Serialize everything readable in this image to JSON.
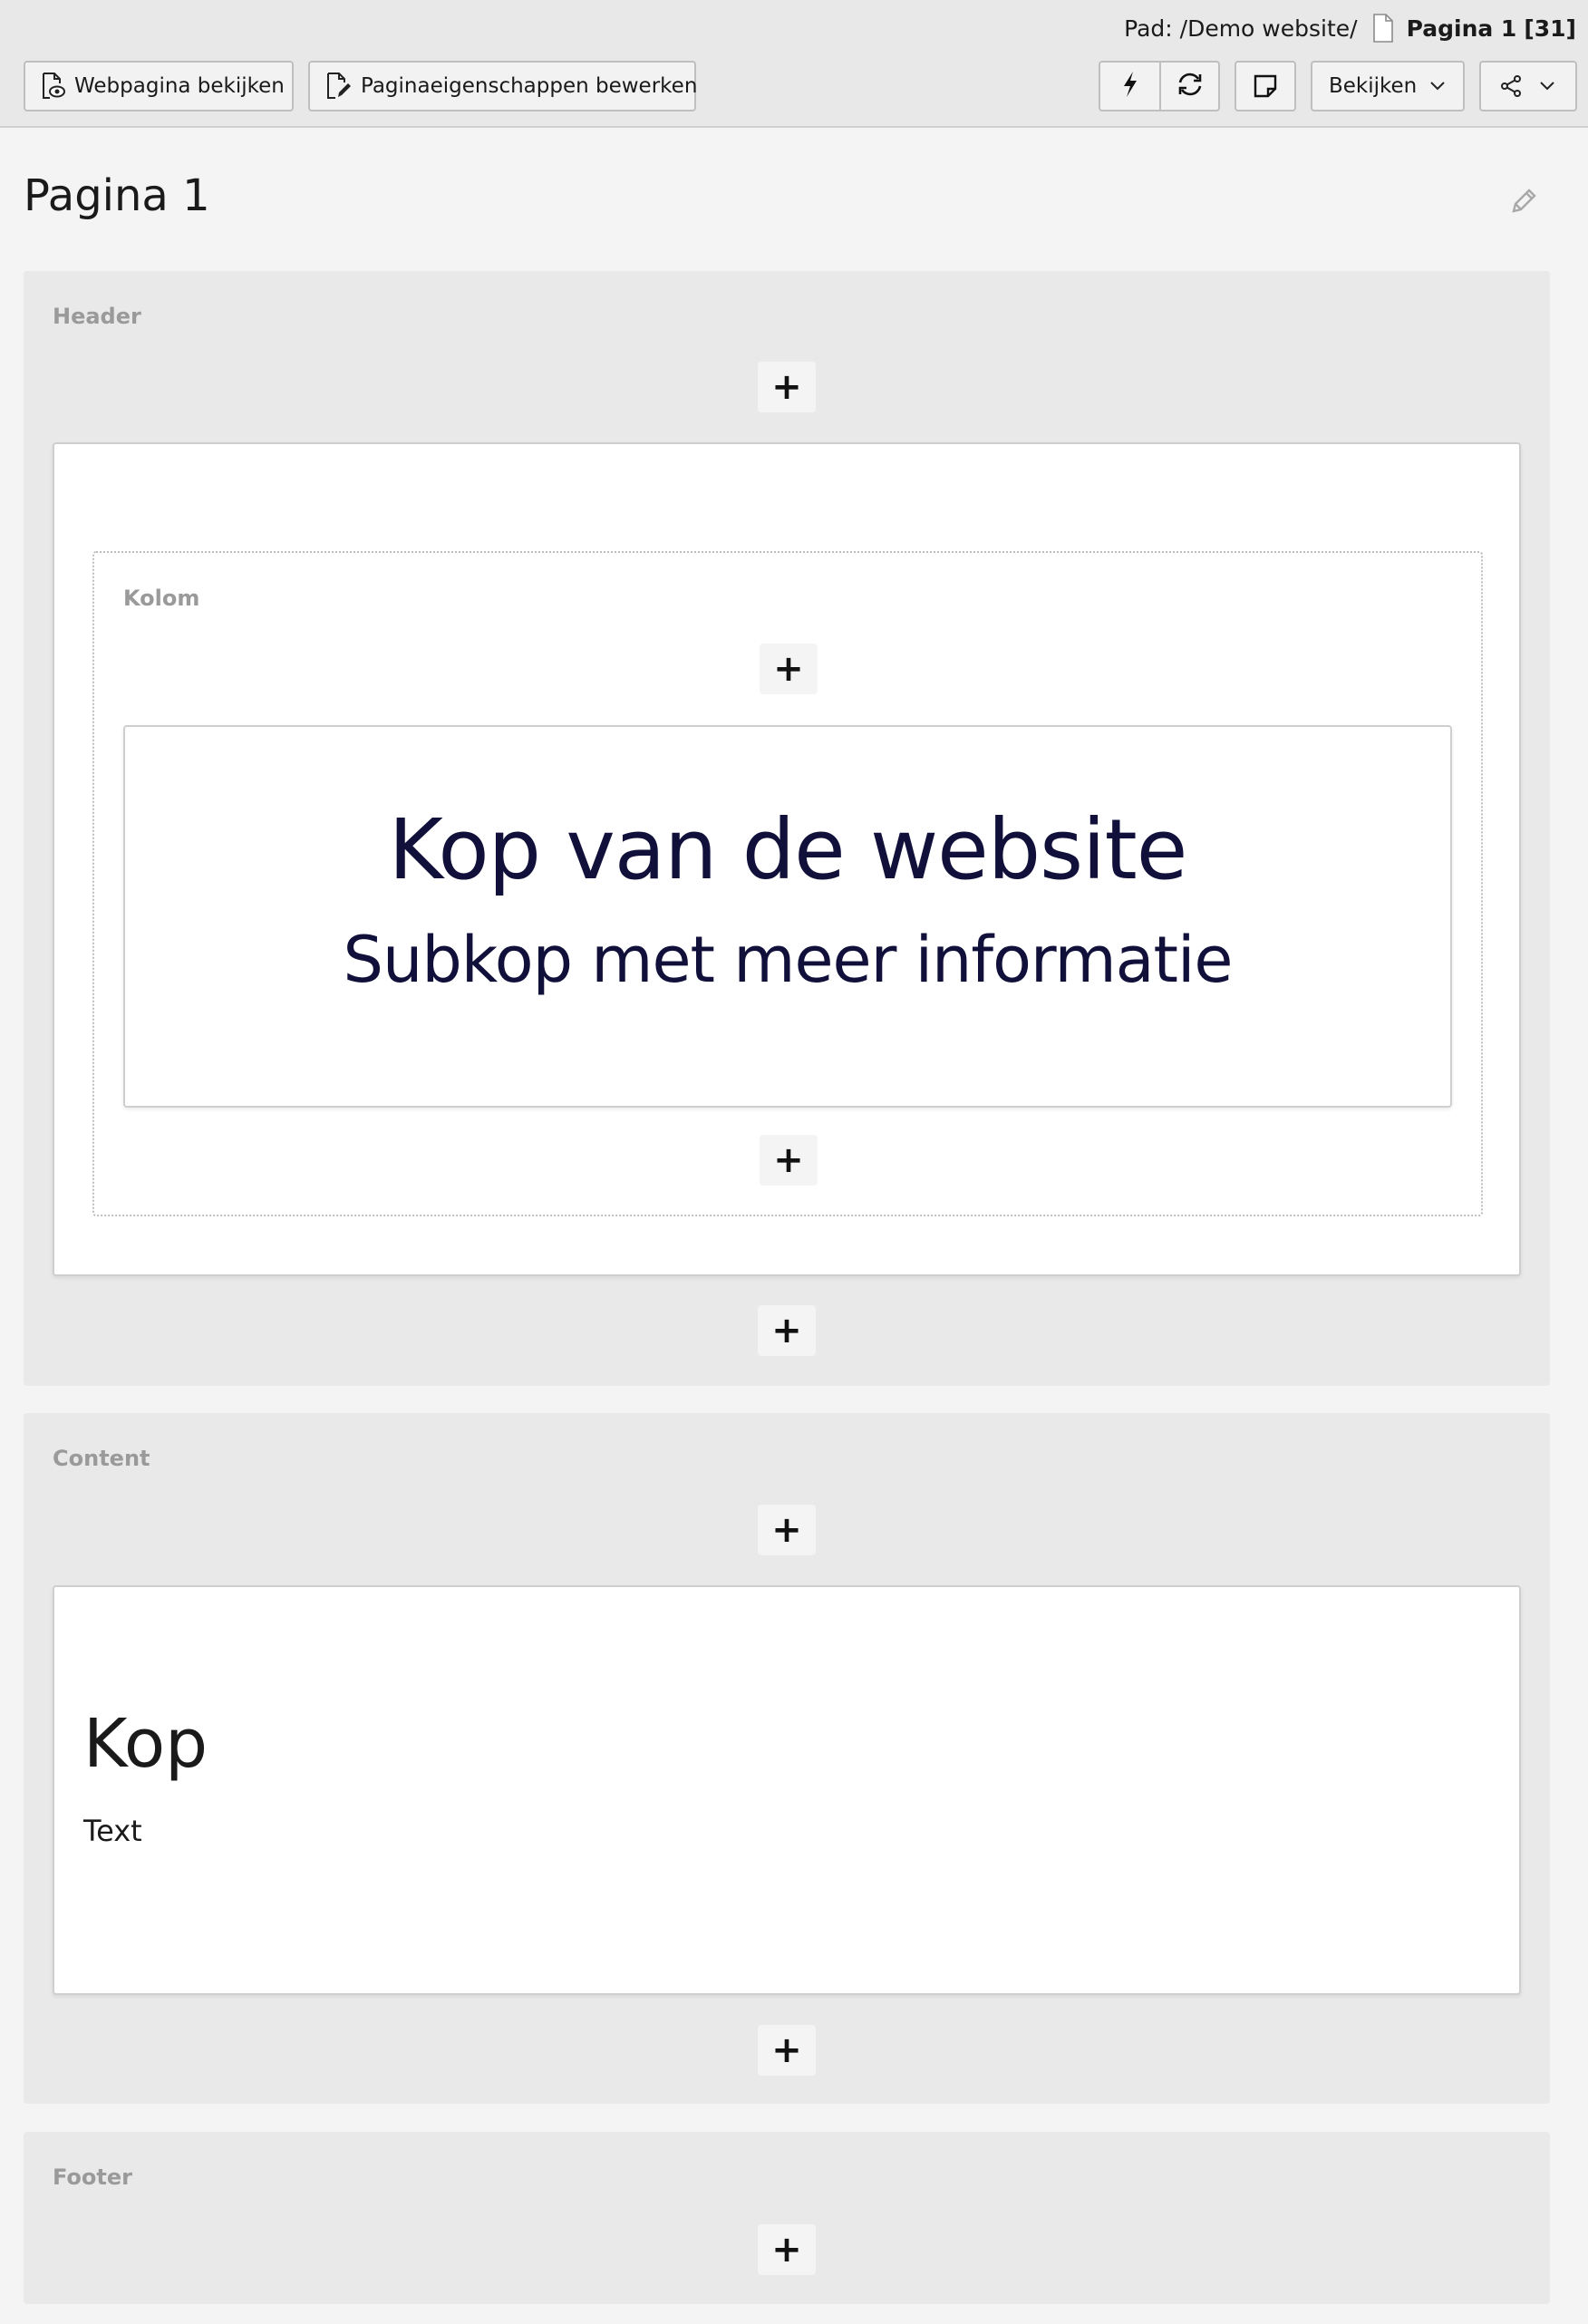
{
  "topbar": {
    "path_prefix": "Pad: /Demo website/",
    "page_name": "Pagina 1",
    "page_id": "[31]",
    "view_page_label": "Webpagina bekijken",
    "page_props_label": "Paginaeigenschappen bewerken",
    "view_label": "Bekijken",
    "icons": {
      "view_page": "eye-document-icon",
      "page_props": "edit-document-icon",
      "clear_cache": "lightning-icon",
      "reload": "refresh-icon",
      "note": "sticky-note-icon",
      "share": "share-icon",
      "dropdown": "chevron-down-icon",
      "doc": "document-icon"
    }
  },
  "page": {
    "title": "Pagina 1",
    "edit_icon": "pencil-icon"
  },
  "sections": {
    "header": {
      "label": "Header",
      "column": {
        "label": "Kolom",
        "hero": {
          "title": "Kop van de website",
          "subtitle": "Subkop met meer informatie"
        }
      }
    },
    "content": {
      "label": "Content",
      "element": {
        "heading": "Kop",
        "text": "Text"
      }
    },
    "footer": {
      "label": "Footer"
    }
  },
  "add_button": "+",
  "colors": {
    "topbar_bg": "#e8e8e8",
    "section_bg": "#e9e9e9",
    "hero_text": "#10103a",
    "label_gray": "#9a9a9a"
  }
}
